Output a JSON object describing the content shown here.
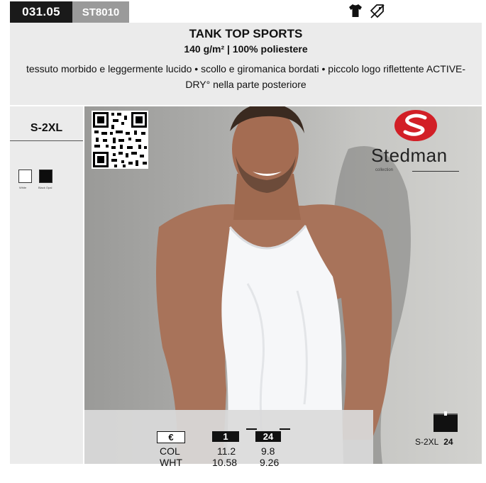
{
  "header": {
    "code": "031.05",
    "sku": "ST8010",
    "icons": [
      "tshirt-icon",
      "no-discount-icon"
    ]
  },
  "product": {
    "title": "TANK TOP SPORTS",
    "subtitle": "140 g/m² | 100% poliestere",
    "description": "tessuto morbido e leggermente lucido • scollo e giromanica bordati • piccolo logo riflettente ACTIVE-DRY° nella parte posteriore"
  },
  "sizes": "S-2XL",
  "colors": [
    {
      "name": "White",
      "hex": "#ffffff"
    },
    {
      "name": "Black Opal",
      "hex": "#0d0d0d"
    }
  ],
  "brand": {
    "name": "Stedman",
    "sub": "collection",
    "mark": "S",
    "color": "#d21f26"
  },
  "pricing": {
    "currency": "€",
    "qty_1": "1",
    "qty_24": "24",
    "rows": [
      {
        "label": "COL",
        "p1": "11.2",
        "p24": "9.8"
      },
      {
        "label": "WHT",
        "p1": "10.58",
        "p24": "9.26"
      }
    ]
  },
  "packaging": {
    "sizes": "S-2XL",
    "qty": "24"
  }
}
